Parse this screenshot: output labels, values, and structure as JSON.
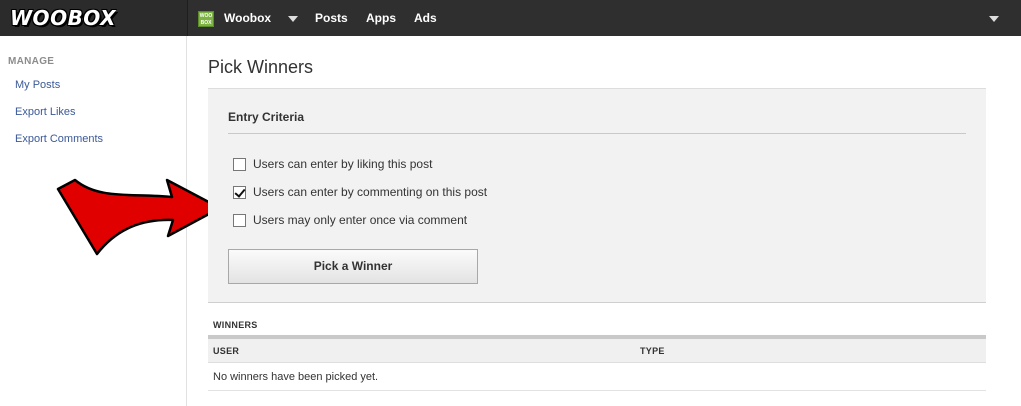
{
  "brand": {
    "logo_text": "WOOBOX"
  },
  "topnav": {
    "app_icon_text": "WOO BOX",
    "account": "Woobox",
    "items": [
      "Posts",
      "Apps",
      "Ads"
    ]
  },
  "sidebar": {
    "heading": "MANAGE",
    "links": [
      "My Posts",
      "Export Likes",
      "Export Comments"
    ]
  },
  "page": {
    "title": "Pick Winners"
  },
  "criteria": {
    "heading": "Entry Criteria",
    "options": [
      {
        "label": "Users can enter by liking this post",
        "checked": false
      },
      {
        "label": "Users can enter by commenting on this post",
        "checked": true
      },
      {
        "label": "Users may only enter once via comment",
        "checked": false
      }
    ],
    "button": "Pick a Winner"
  },
  "winners": {
    "heading": "WINNERS",
    "columns": [
      "USER",
      "TYPE"
    ],
    "empty_message": "No winners have been picked yet."
  },
  "colors": {
    "topbar": "#2f2f2f",
    "link": "#3b5998",
    "arrow": "#e00000",
    "panel": "#f2f2f2"
  }
}
